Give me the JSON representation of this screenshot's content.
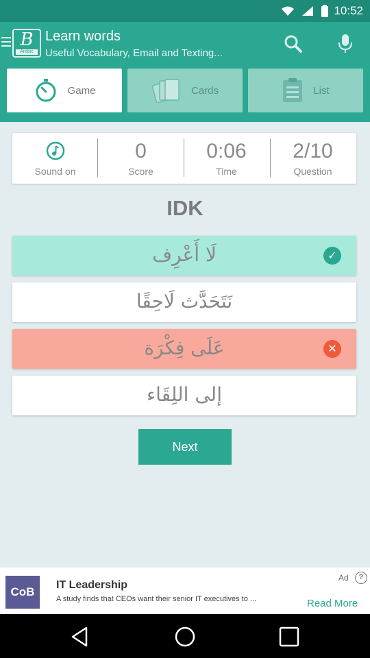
{
  "status_bar": {
    "time": "10:52"
  },
  "app_bar": {
    "title": "Learn words",
    "subtitle": "Useful Vocabulary, Email and Texting...",
    "logo_letter": "B",
    "logo_language": "Arabic"
  },
  "tabs": [
    {
      "label": "Game",
      "icon": "stopwatch-icon",
      "active": true
    },
    {
      "label": "Cards",
      "icon": "cards-icon",
      "active": false
    },
    {
      "label": "List",
      "icon": "clipboard-icon",
      "active": false
    }
  ],
  "stats": {
    "sound": {
      "label": "Sound on",
      "icon": "music-note-icon"
    },
    "score": {
      "value": "0",
      "label": "Score"
    },
    "time": {
      "value": "0:06",
      "label": "Time"
    },
    "question": {
      "value": "2/10",
      "label": "Question"
    }
  },
  "question_word": "IDK",
  "answers": [
    {
      "text": "لَا أَعْرِف",
      "state": "correct"
    },
    {
      "text": "نَتَحَدَّث لَاحِقًا",
      "state": "neutral"
    },
    {
      "text": "عَلَى فِكْرَة",
      "state": "wrong"
    },
    {
      "text": "إلى اللِقَاء",
      "state": "neutral"
    }
  ],
  "next_label": "Next",
  "ad": {
    "logo_text": "CoB",
    "title": "IT Leadership",
    "description": "A study finds that CEOs want their senior IT executives to ...",
    "label": "Ad",
    "cta": "Read More"
  },
  "colors": {
    "primary": "#2aa891",
    "status_bar": "#1e8a78",
    "correct": "#a7eadb",
    "wrong": "#f9a99b",
    "background": "#e3ecef"
  }
}
